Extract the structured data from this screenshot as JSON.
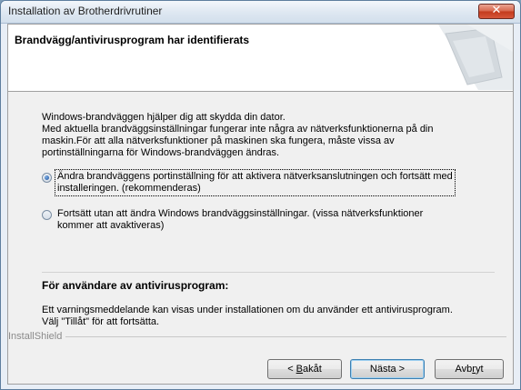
{
  "window": {
    "title": "Installation av Brotherdrivrutiner",
    "close_glyph": "✕"
  },
  "header": {
    "title": "Brandvägg/antivirusprogram har identifierats"
  },
  "intro": {
    "lines": [
      "Windows-brandväggen hjälper dig att skydda din dator.",
      "Med aktuella brandväggsinställningar fungerar inte några av nätverksfunktionerna på din",
      "maskin.För att alla nätverksfunktioner på maskinen ska fungera, måste vissa av",
      "portinställningarna för Windows-brandväggen ändras."
    ]
  },
  "options": [
    {
      "lines": [
        "Ändra brandväggens portinställning för att aktivera nätverksanslutningen och fortsätt med",
        "installeringen. (rekommenderas)"
      ],
      "selected": true
    },
    {
      "lines": [
        "Fortsätt utan att ändra Windows brandväggsinställningar. (vissa nätverksfunktioner",
        "kommer att avaktiveras)"
      ],
      "selected": false
    }
  ],
  "antivirus": {
    "heading": "För användare av antivirusprogram:",
    "lines": [
      "Ett varningsmeddelande kan visas under installationen om du använder ett antivirusprogram.",
      "Välj \"Tillåt\" för att fortsätta."
    ]
  },
  "footer": {
    "brand": "InstallShield"
  },
  "buttons": {
    "back": {
      "pre": "< ",
      "accel": "B",
      "rest": "akåt"
    },
    "next": {
      "label": "Nästa >"
    },
    "cancel": {
      "pre": "Avb",
      "accel": "r",
      "rest": "yt"
    }
  },
  "colors": {
    "accent": "#3c7fb1",
    "close": "#c33a1d"
  }
}
